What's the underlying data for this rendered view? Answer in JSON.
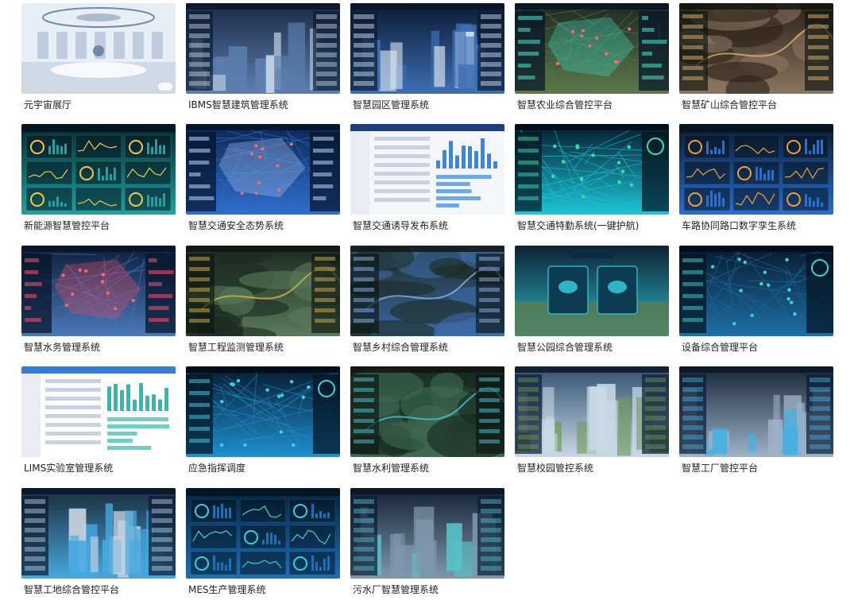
{
  "gallery": {
    "items": [
      {
        "label": "元宇宙展厅",
        "theme": "metaverse",
        "colors": [
          "#b8c8dc",
          "#e8eef6",
          "#6e8aa8"
        ]
      },
      {
        "label": "IBMS智慧建筑管理系统",
        "theme": "city",
        "colors": [
          "#1a2a44",
          "#5d7fb0",
          "#c9d6e6"
        ]
      },
      {
        "label": "智慧园区管理系统",
        "theme": "city",
        "colors": [
          "#0b1a34",
          "#3c6fb4",
          "#e0e7f0"
        ]
      },
      {
        "label": "智慧农业综合管控平台",
        "theme": "map",
        "colors": [
          "#1d2a1f",
          "#5a7a4c",
          "#3fd6c2"
        ]
      },
      {
        "label": "智慧矿山综合管控平台",
        "theme": "terrain",
        "colors": [
          "#2a2218",
          "#8a7560",
          "#d9b36a"
        ]
      },
      {
        "label": "新能源智慧管控平台",
        "theme": "dashboard",
        "colors": [
          "#07262b",
          "#1fa3a0",
          "#f3c845"
        ]
      },
      {
        "label": "智慧交通安全态势系统",
        "theme": "map",
        "colors": [
          "#0c2550",
          "#2f6fd0",
          "#a8c4f2"
        ]
      },
      {
        "label": "智慧交通诱导发布系统",
        "theme": "form",
        "colors": [
          "#f4f6fa",
          "#1f3f7a",
          "#2e8ae6"
        ]
      },
      {
        "label": "智慧交通特勤系统(一键护航)",
        "theme": "network",
        "colors": [
          "#051a2c",
          "#1cc6d8",
          "#38e0a8"
        ]
      },
      {
        "label": "车路协同路口数字孪生系统",
        "theme": "dashboard",
        "colors": [
          "#0a1626",
          "#2a6fd0",
          "#f0a030"
        ]
      },
      {
        "label": "智慧水务管理系统",
        "theme": "map",
        "colors": [
          "#0b1f3b",
          "#4a78b8",
          "#e74a6a"
        ]
      },
      {
        "label": "智慧工程监测管理系统",
        "theme": "terrain",
        "colors": [
          "#1b2a22",
          "#587a58",
          "#d6b24a"
        ]
      },
      {
        "label": "智慧乡村综合管理系统",
        "theme": "terrain",
        "colors": [
          "#1c2b22",
          "#3a6aa8",
          "#8bb0e8"
        ]
      },
      {
        "label": "智慧公园综合管理系统",
        "theme": "park",
        "colors": [
          "#0d2233",
          "#2bb6c8",
          "#5a7a4c"
        ]
      },
      {
        "label": "设备综合管理平台",
        "theme": "network",
        "colors": [
          "#071a2e",
          "#1e6fa8",
          "#3ad6c8"
        ]
      },
      {
        "label": "LIMS实验室管理系统",
        "theme": "form",
        "colors": [
          "#ffffff",
          "#2e7fd6",
          "#2bbcb0"
        ]
      },
      {
        "label": "应急指挥调度",
        "theme": "network",
        "colors": [
          "#061a2c",
          "#1e8fd0",
          "#43d1e0"
        ]
      },
      {
        "label": "智慧水利管理系统",
        "theme": "terrain",
        "colors": [
          "#152820",
          "#3f6a52",
          "#48c8d8"
        ]
      },
      {
        "label": "智慧校园管控系统",
        "theme": "city",
        "colors": [
          "#31506e",
          "#c9d8e6",
          "#6f9a58"
        ]
      },
      {
        "label": "智慧工厂管控平台",
        "theme": "city",
        "colors": [
          "#16263a",
          "#9fb3c8",
          "#46b0e0"
        ]
      },
      {
        "label": "智慧工地综合管控平台",
        "theme": "city",
        "colors": [
          "#1a2a3a",
          "#46a8e0",
          "#c8d2dc"
        ]
      },
      {
        "label": "MES生产管理系统",
        "theme": "dashboard",
        "colors": [
          "#062038",
          "#1d6fb8",
          "#36d2d6"
        ]
      },
      {
        "label": "污水厂智慧管理系统",
        "theme": "city",
        "colors": [
          "#132235",
          "#7f97ad",
          "#57c2c8"
        ]
      }
    ]
  }
}
